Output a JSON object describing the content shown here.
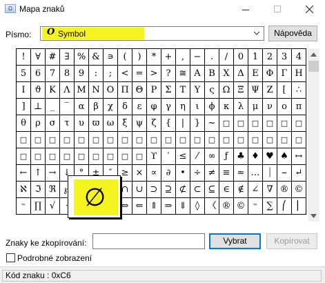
{
  "window": {
    "title": "Mapa znaků",
    "app_icon_text": "Ω"
  },
  "font_row": {
    "label": "Písmo:",
    "font_icon": "O",
    "selected_font": "Symbol",
    "help_label": "Nápověda"
  },
  "grid": [
    [
      "!",
      "∀",
      "#",
      "∃",
      "%",
      "&",
      "∍",
      "(",
      ")",
      "*",
      "+",
      ",",
      "−",
      ".",
      "/",
      "0",
      "1",
      "2",
      "3",
      "4"
    ],
    [
      "5",
      "6",
      "7",
      "8",
      "9",
      ":",
      ";",
      "<",
      "=",
      ">",
      "?",
      "≅",
      "Α",
      "Β",
      "Χ",
      "Δ",
      "Ε",
      "Φ",
      "Γ",
      "Η"
    ],
    [
      "Ι",
      "ϑ",
      "Κ",
      "Λ",
      "Μ",
      "Ν",
      "Ο",
      "Π",
      "Θ",
      "Ρ",
      "Σ",
      "Τ",
      "Υ",
      "ς",
      "Ω",
      "Ξ",
      "Ψ",
      "Ζ",
      "[",
      "∴"
    ],
    [
      "]",
      "⊥",
      "_",
      "‾",
      "α",
      "β",
      "χ",
      "δ",
      "ε",
      "φ",
      "γ",
      "η",
      "ι",
      "ϕ",
      "κ",
      "λ",
      "μ",
      "ν",
      "ο",
      "π"
    ],
    [
      "θ",
      "ρ",
      "σ",
      "τ",
      "υ",
      "ϖ",
      "ω",
      "ξ",
      "ψ",
      "ζ",
      "{",
      "|",
      "}",
      "~",
      "□",
      "□",
      "□",
      "□",
      "□",
      "□"
    ],
    [
      "□",
      "□",
      "□",
      "□",
      "□",
      "□",
      "□",
      "□",
      "□",
      "□",
      "□",
      "□",
      "□",
      "□",
      "□",
      "□",
      "□",
      "□",
      "□",
      "□"
    ],
    [
      "□",
      "□",
      "□",
      "□",
      "□",
      "□",
      "□",
      "□",
      "□",
      "ϒ",
      "′",
      "≤",
      "⁄",
      "∞",
      "ƒ",
      "♣",
      "♦",
      "♥",
      "♠",
      "↔"
    ],
    [
      "←",
      "↑",
      "→",
      "↓",
      "°",
      "±",
      "″",
      "≥",
      "×",
      "∝",
      "∂",
      "•",
      "÷",
      "≠",
      "≡",
      "≈",
      "…",
      "⏐",
      "⎯",
      "↵"
    ],
    [
      "ℵ",
      "ℑ",
      "ℜ",
      "℘",
      "⊗",
      "⊕",
      "∅",
      "∩",
      "∪",
      "⊃",
      "⊇",
      "⊄",
      "⊂",
      "⊆",
      "∈",
      "∉",
      "∠",
      "∇",
      "®",
      "©"
    ],
    [
      "™",
      "∏",
      "√",
      "⋅",
      "¬",
      "∧",
      "∨",
      "⇔",
      "⇐",
      "⇑",
      "⇒",
      "⇓",
      "◊",
      "〈",
      "®",
      "©",
      "™",
      "∑",
      "⎛",
      "⎜"
    ]
  ],
  "magnifier": {
    "glyph": "∅"
  },
  "copy_row": {
    "label": "Znaky ke zkopírování:",
    "value": "",
    "select_label": "Vybrat",
    "copy_label": "Kopírovat"
  },
  "advanced": {
    "label": "Podrobné zobrazení",
    "checked": false
  },
  "status": {
    "text": "Kód znaku : 0xC6"
  },
  "colors": {
    "highlight": "#f5f320",
    "accent": "#0078d7"
  }
}
